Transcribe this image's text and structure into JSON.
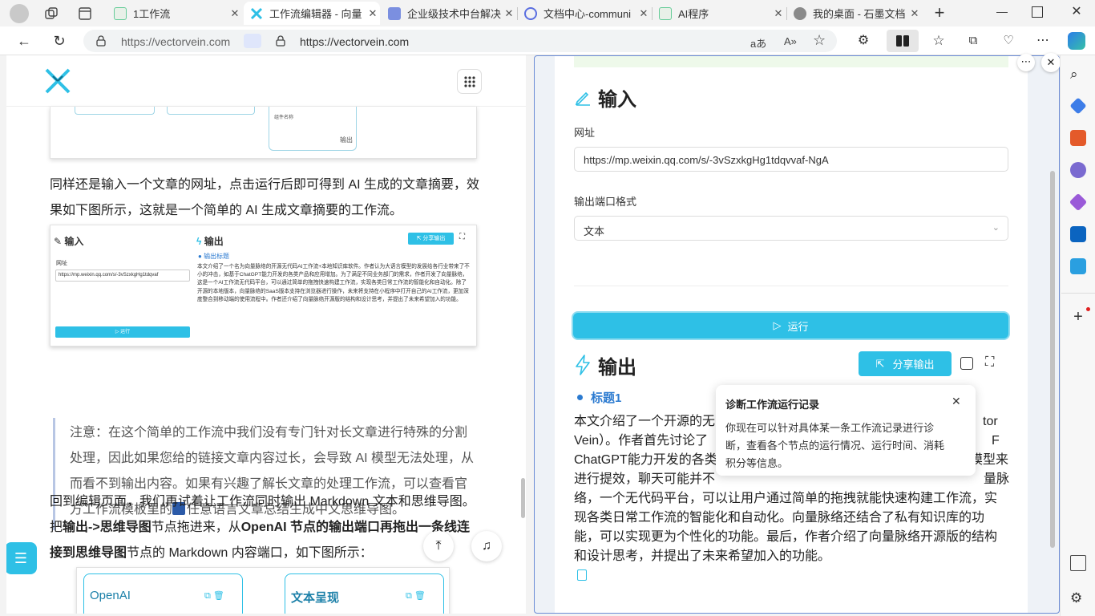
{
  "browser": {
    "tabs": [
      {
        "label": "1工作流",
        "active": false
      },
      {
        "label": "工作流编辑器 - 向量",
        "active": true
      },
      {
        "label": "企业级技术中台解决",
        "active": false
      },
      {
        "label": "文档中心-communi",
        "active": false
      },
      {
        "label": "AI程序",
        "active": false
      },
      {
        "label": "我的桌面 - 石墨文档",
        "active": false
      }
    ],
    "address": {
      "left_url": "https://vectorvein.com",
      "right_url": "https://vectorvein.com"
    }
  },
  "doc": {
    "para1": "同样还是输入一个文章的网址，点击运行后即可得到 AI 生成的文章摘要，效果如下图所示，这就是一个简单的 AI 生成文章摘要的工作流。",
    "note": "注意：在这个简单的工作流中我们没有专门针对长文章进行特殊的分割处理，因此如果您给的链接文章内容过长，会导致 AI 模型无法处理，从而看不到输出内容。如果有兴趣了解长文章的处理工作流，可以查看官方工作流模板里的",
    "note_link": "任意语言文章总结生成中文思维导图。",
    "para2_a": "回到编辑页面，我们再试着让工作流同时输出 Markdown 文本和思维导图。把",
    "para2_b": "输出->思维导图",
    "para2_c": "节点拖进来，从",
    "para2_d": "OpenAI 节点的输出端口再拖出一条线连接到思维导图",
    "para2_e": "节点的 Markdown 内容端口，如下图所示：",
    "top_figure": {
      "output_label": "输出",
      "small_label": "组件名称"
    },
    "screenshot": {
      "input_title": "输入",
      "output_title": "输出",
      "share_label": "分享输出",
      "url_label": "网址",
      "url_value": "https://mp.weixin.qq.com/s/-3vSzxkgHg1tdqvaf",
      "run_label": "运行",
      "subtitle": "输出标题",
      "summary": "本文介绍了一个名为向量脉络的开源无代码AI工作流+本地知识库软件。作者认为大语言模型的发展给各行业带来了不小的冲击，如基于ChatGPT能力开发的各类产品和应用增加。为了满足不同业务部门的需求，作者开发了向量脉络，这是一个AI工作流无代码平台，可以通过简单的拖拽快速构建工作流，实现各类日常工作流的智能化和自动化。除了开源的本地版本，向量脉络的SaaS版本支持在浏览器进行操作，未来将支持在小程序中打开自己的AI工作流，更加深度整合到移动端的使用流程中。作者还介绍了向量脉络开源版的结构和设计思考，并提出了未来希望加入的功能。"
    },
    "bottom_figure": {
      "node1": "OpenAI",
      "node2": "文本呈现"
    }
  },
  "panel": {
    "input_title": "输入",
    "url_label": "网址",
    "url_value": "https://mp.weixin.qq.com/s/-3vSzxkgHg1tdqvvaf-NgA",
    "format_label": "输出端口格式",
    "format_value": "文本",
    "run_label": "运行",
    "output_title": "输出",
    "share_label": "分享输出",
    "subtitle": "标题1",
    "out_lines": [
      "本文介绍了一个开源的无",
      "Vein）。作者首先讨论了",
      "ChatGPT能力开发的各类",
      "进行提效，聊天可能并不",
      "络，一个无代码平台，可以让用户通过简单的拖拽就能快速构建工作流，实",
      "现各类日常工作流的智能化和自动化。向量脉络还结合了私有知识库的功",
      "能，可以实现更为个性化的功能。最后，作者介绍了向量脉络开源版的结构",
      "和设计思考，并提出了未来希望加入的功能。"
    ],
    "out_tails": [
      "tor",
      "F",
      "模型来",
      "量脉"
    ]
  },
  "tooltip": {
    "title": "诊断工作流运行记录",
    "body_lines": [
      "你现在可以针对具体某一条工作流记录进行诊",
      "断，查看各个节点的运行情况、运行时间、消耗",
      "积分等信息。"
    ]
  },
  "colors": {
    "accent": "#2ec0e6",
    "quote_border": "#b8c6e4",
    "pane_border": "#6b8cd6"
  }
}
